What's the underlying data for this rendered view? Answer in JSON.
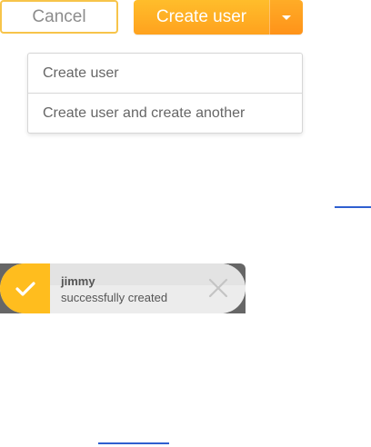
{
  "actions": {
    "cancel_label": "Cancel",
    "create_label": "Create user"
  },
  "dropdown": {
    "items": [
      {
        "label": "Create user"
      },
      {
        "label": "Create user and create another"
      }
    ]
  },
  "toast": {
    "title": "jimmy",
    "message": "successfully created",
    "icon": "check-icon",
    "close_icon": "close-icon"
  },
  "colors": {
    "accent": "#ffa21e",
    "accent_light": "#ffbd2b",
    "border_accent": "#f7c44a",
    "link": "#2f5fd0",
    "text": "#666666"
  }
}
